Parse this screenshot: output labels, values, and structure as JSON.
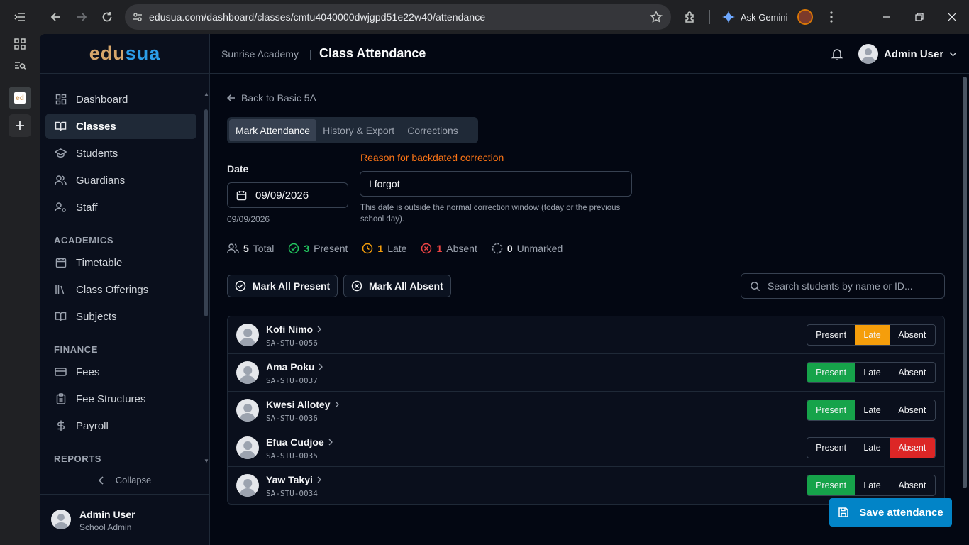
{
  "browser": {
    "url": "edusua.com/dashboard/classes/cmtu4040000dwjgpd51e22w40/attendance",
    "gemini_label": "Ask Gemini"
  },
  "sidebar": {
    "logo_part1": "edu",
    "logo_part2": "sua",
    "items": [
      {
        "label": "Dashboard",
        "icon": "dashboard-icon"
      },
      {
        "label": "Classes",
        "icon": "book-open-icon",
        "active": true
      },
      {
        "label": "Students",
        "icon": "graduation-cap-icon"
      },
      {
        "label": "Guardians",
        "icon": "users-icon"
      },
      {
        "label": "Staff",
        "icon": "user-cog-icon"
      }
    ],
    "academics_title": "ACADEMICS",
    "academics_items": [
      {
        "label": "Timetable",
        "icon": "calendar-icon"
      },
      {
        "label": "Class Offerings",
        "icon": "library-icon"
      },
      {
        "label": "Subjects",
        "icon": "book-icon"
      }
    ],
    "finance_title": "FINANCE",
    "finance_items": [
      {
        "label": "Fees",
        "icon": "credit-card-icon"
      },
      {
        "label": "Fee Structures",
        "icon": "clipboard-icon"
      },
      {
        "label": "Payroll",
        "icon": "dollar-icon"
      }
    ],
    "reports_title": "REPORTS",
    "collapse_label": "Collapse",
    "user": {
      "name": "Admin User",
      "role": "School Admin"
    }
  },
  "header": {
    "school": "Sunrise Academy",
    "title": "Class Attendance",
    "user_name": "Admin User"
  },
  "main": {
    "back_label": "Back to Basic 5A",
    "tabs": [
      "Mark Attendance",
      "History & Export",
      "Corrections"
    ],
    "date_label": "Date",
    "date_value": "09/09/2026",
    "date_sub": "09/09/2026",
    "reason_label": "Reason for backdated correction",
    "reason_value": "I forgot",
    "reason_help": "This date is outside the normal correction window (today or the previous school day).",
    "stats": {
      "total": "5",
      "total_label": "Total",
      "present": "3",
      "present_label": "Present",
      "late": "1",
      "late_label": "Late",
      "absent": "1",
      "absent_label": "Absent",
      "unmarked": "0",
      "unmarked_label": "Unmarked"
    },
    "mark_all_present": "Mark All Present",
    "mark_all_absent": "Mark All Absent",
    "search_placeholder": "Search students by name or ID...",
    "status_labels": {
      "present": "Present",
      "late": "Late",
      "absent": "Absent"
    },
    "students": [
      {
        "name": "Kofi Nimo",
        "id": "SA-STU-0056",
        "status": "late"
      },
      {
        "name": "Ama Poku",
        "id": "SA-STU-0037",
        "status": "present"
      },
      {
        "name": "Kwesi Allotey",
        "id": "SA-STU-0036",
        "status": "present"
      },
      {
        "name": "Efua Cudjoe",
        "id": "SA-STU-0035",
        "status": "absent"
      },
      {
        "name": "Yaw Takyi",
        "id": "SA-STU-0034",
        "status": "present"
      }
    ],
    "save_label": "Save attendance"
  },
  "colors": {
    "present": "#16a34a",
    "late": "#f59e0b",
    "absent": "#dc2626",
    "accent": "#0284c7",
    "warning": "#f97316"
  }
}
